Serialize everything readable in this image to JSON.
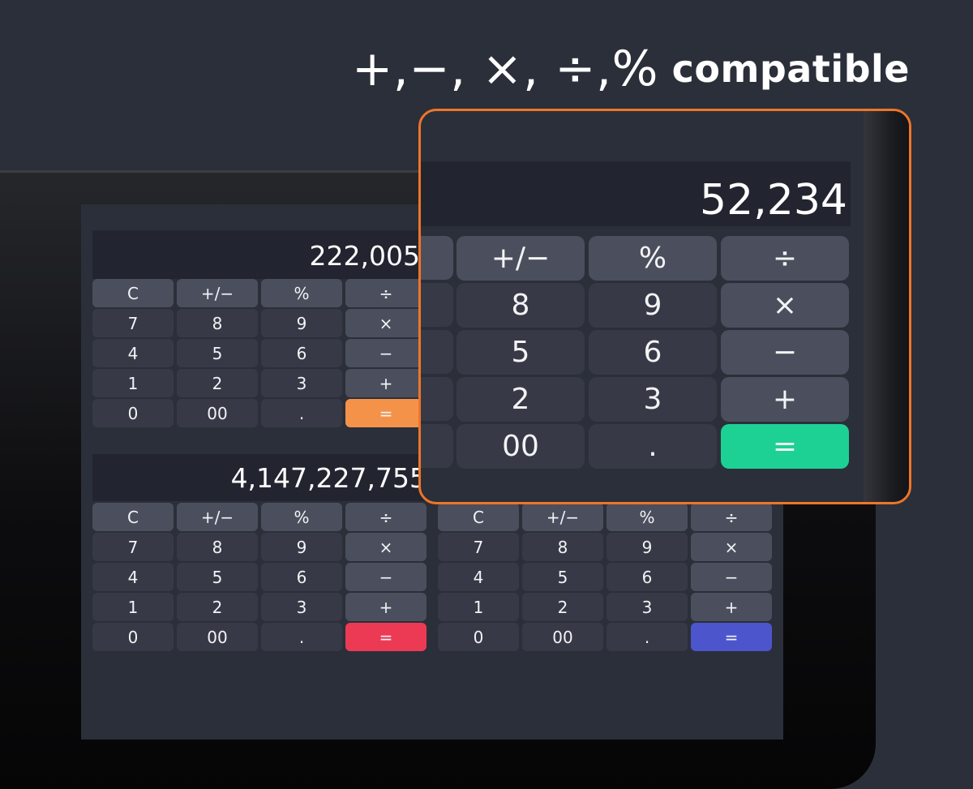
{
  "headline": {
    "symbols": "+,−, ×, ÷,%",
    "text": "compatible"
  },
  "calculators": {
    "top": {
      "display": "222,005",
      "keys": [
        [
          "C",
          "+/−",
          "%",
          "÷"
        ],
        [
          "7",
          "8",
          "9",
          "×"
        ],
        [
          "4",
          "5",
          "6",
          "−"
        ],
        [
          "1",
          "2",
          "3",
          "+"
        ],
        [
          "0",
          "00",
          ".",
          "="
        ]
      ],
      "equals_color": "#f5924a"
    },
    "bottom_left": {
      "display": "4,147,227,755",
      "keys": [
        [
          "C",
          "+/−",
          "%",
          "÷"
        ],
        [
          "7",
          "8",
          "9",
          "×"
        ],
        [
          "4",
          "5",
          "6",
          "−"
        ],
        [
          "1",
          "2",
          "3",
          "+"
        ],
        [
          "0",
          "00",
          ".",
          "="
        ]
      ],
      "equals_color": "#ec3a55"
    },
    "bottom_right": {
      "keys": [
        [
          "C",
          "+/−",
          "%",
          "÷"
        ],
        [
          "7",
          "8",
          "9",
          "×"
        ],
        [
          "4",
          "5",
          "6",
          "−"
        ],
        [
          "1",
          "2",
          "3",
          "+"
        ],
        [
          "0",
          "00",
          ".",
          "="
        ]
      ],
      "equals_color": "#4c55cc"
    }
  },
  "zoom": {
    "display": "52,234",
    "keys": [
      [
        "+/−",
        "%",
        "÷"
      ],
      [
        "8",
        "9",
        "×"
      ],
      [
        "5",
        "6",
        "−"
      ],
      [
        "2",
        "3",
        "+"
      ],
      [
        "00",
        ".",
        "="
      ]
    ],
    "equals_color": "#1dd195",
    "border_color": "#ef7527"
  }
}
